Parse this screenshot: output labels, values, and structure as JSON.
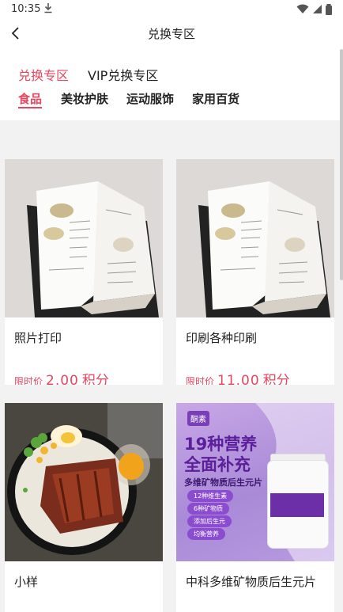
{
  "status_bar": {
    "time": "10:35"
  },
  "header": {
    "title": "兑换专区"
  },
  "zone_tabs": [
    {
      "label": "兑换专区",
      "active": true
    },
    {
      "label": "VIP兑换专区",
      "active": false
    }
  ],
  "category_tabs": [
    {
      "label": "食品",
      "active": true
    },
    {
      "label": "美妆护肤",
      "active": false
    },
    {
      "label": "运动服饰",
      "active": false
    },
    {
      "label": "家用百货",
      "active": false
    }
  ],
  "products": [
    {
      "name": "照片打印",
      "price_label": "限时价",
      "price": "2.00",
      "unit": "积分"
    },
    {
      "name": "印刷各种印刷",
      "price_label": "限时价",
      "price": "11.00",
      "unit": "积分"
    },
    {
      "name": "小样"
    },
    {
      "name": "中科多维矿物质后生元片"
    }
  ],
  "supplement_image": {
    "brand": "酮素",
    "headline_1": "19种营养",
    "headline_2": "全面补充",
    "subtitle": "多维矿物质后生元片",
    "pills": [
      "12种维生素",
      "6种矿物质",
      "添加后生元",
      "均衡营养"
    ]
  },
  "colors": {
    "accent": "#e8465f",
    "background": "#f2f2f2"
  }
}
